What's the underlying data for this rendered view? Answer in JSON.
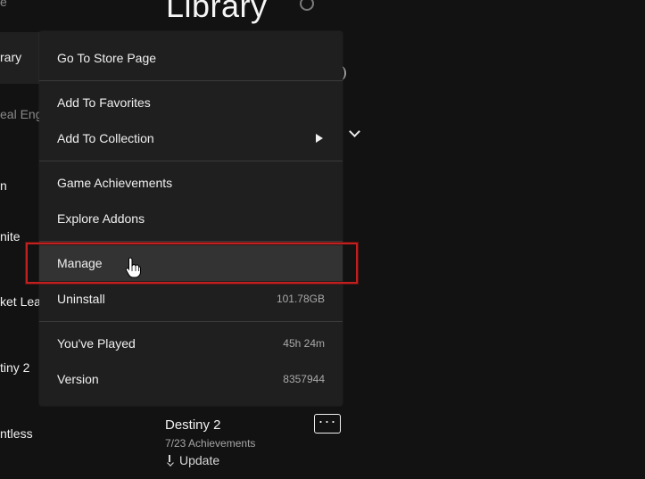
{
  "page": {
    "title": "Library"
  },
  "sidebar": {
    "items": [
      {
        "label": "e",
        "style": "dim"
      },
      {
        "label": "rary",
        "style": "active"
      },
      {
        "label": "eal Eng",
        "style": "dim"
      },
      {
        "label": "n",
        "style": "normal"
      },
      {
        "label": "nite",
        "style": "normal"
      },
      {
        "label": "ket Lea",
        "style": "normal"
      },
      {
        "label": "tiny 2",
        "style": "normal"
      },
      {
        "label": "ntless",
        "style": "normal"
      }
    ]
  },
  "context_menu": {
    "items": [
      {
        "label": "Go To Store Page",
        "value": ""
      },
      {
        "label": "Add To Favorites",
        "value": ""
      },
      {
        "label": "Add To Collection",
        "value": ""
      },
      {
        "label": "Game Achievements",
        "value": ""
      },
      {
        "label": "Explore Addons",
        "value": ""
      },
      {
        "label": "Manage",
        "value": ""
      },
      {
        "label": "Uninstall",
        "value": "101.78GB"
      },
      {
        "label": "You've Played",
        "value": "45h 24m"
      },
      {
        "label": "Version",
        "value": "8357944"
      }
    ]
  },
  "game_card": {
    "title": "Destiny 2",
    "achievements": "7/23 Achievements",
    "action": "Update",
    "more_label": "···"
  },
  "colors": {
    "background": "#121212",
    "menu": "#1f1f1f",
    "highlight_row": "#333333",
    "annotation": "#c21f1f"
  }
}
